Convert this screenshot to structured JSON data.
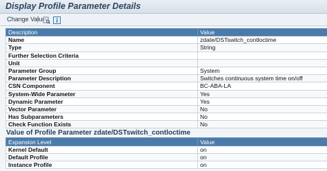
{
  "window": {
    "title": "Display Profile Parameter Details"
  },
  "toolbar": {
    "change_value": "Change Value"
  },
  "details_table": {
    "headers": [
      "Description",
      "Value"
    ],
    "rows": [
      [
        "Name",
        "zdate/DSTswitch_contloctime"
      ],
      [
        "Type",
        "String"
      ],
      [
        "Further Selection Criteria",
        ""
      ],
      [
        "Unit",
        ""
      ],
      [
        "Parameter Group",
        "System"
      ],
      [
        "Parameter Description",
        "Switches continuous system time on/off"
      ],
      [
        "CSN Component",
        "BC-ABA-LA"
      ],
      [
        "System-Wide Parameter",
        "Yes"
      ],
      [
        "Dynamic Parameter",
        "Yes"
      ],
      [
        "Vector Parameter",
        "No"
      ],
      [
        "Has Subparameters",
        "No"
      ],
      [
        "Check Function Exists",
        "No"
      ]
    ]
  },
  "value_section": {
    "title": "Value of Profile Parameter zdate/DSTswitch_contloctime",
    "headers": [
      "Expansion Level",
      "Value"
    ],
    "rows": [
      [
        "Kernel Default",
        "on"
      ],
      [
        "Default Profile",
        "on"
      ],
      [
        "Instance Profile",
        "on"
      ]
    ]
  }
}
